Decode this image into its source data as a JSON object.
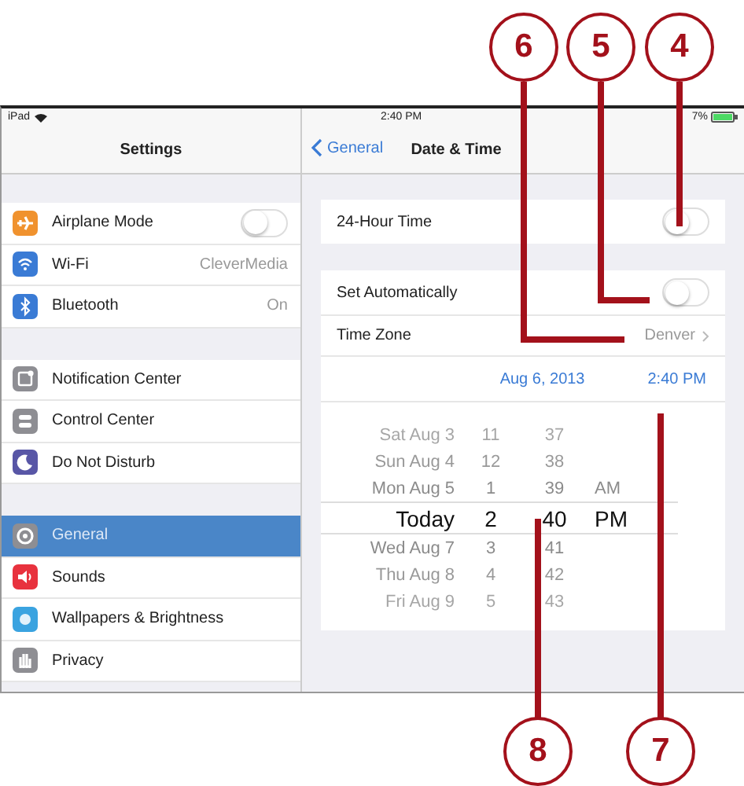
{
  "status_bar": {
    "device": "iPad",
    "time": "2:40 PM",
    "battery": "7%"
  },
  "sidebar": {
    "title": "Settings",
    "groups": [
      [
        {
          "label": "Airplane Mode",
          "kind": "toggle",
          "on": false,
          "color": "#f0922e",
          "selected": false
        },
        {
          "label": "Wi-Fi",
          "kind": "value",
          "value": "CleverMedia",
          "color": "#3a7bd5",
          "selected": false
        },
        {
          "label": "Bluetooth",
          "kind": "value",
          "value": "On",
          "color": "#3a7bd5",
          "selected": false
        }
      ],
      [
        {
          "label": "Notification Center",
          "kind": "link",
          "color": "#8e8e93",
          "selected": false
        },
        {
          "label": "Control Center",
          "kind": "link",
          "color": "#8e8e93",
          "selected": false
        },
        {
          "label": "Do Not Disturb",
          "kind": "link",
          "color": "#5856a6",
          "selected": false
        }
      ],
      [
        {
          "label": "General",
          "kind": "link",
          "color": "#8e8e93",
          "selected": true
        },
        {
          "label": "Sounds",
          "kind": "link",
          "color": "#e8323e",
          "selected": false
        },
        {
          "label": "Wallpapers & Brightness",
          "kind": "link",
          "color": "#3aa3e0",
          "selected": false
        },
        {
          "label": "Privacy",
          "kind": "link",
          "color": "#8e8e93",
          "selected": false
        }
      ]
    ]
  },
  "detail": {
    "back": "General",
    "title": "Date & Time",
    "hour24": {
      "label": "24-Hour Time",
      "on": false
    },
    "set_auto": {
      "label": "Set Automatically",
      "on": false
    },
    "time_zone": {
      "label": "Time Zone",
      "value": "Denver"
    },
    "date": "Aug 6, 2013",
    "time": "2:40 PM",
    "picker": [
      {
        "day": "Sat Aug 3",
        "hour": "11",
        "minute": "37",
        "selected": false
      },
      {
        "day": "Sun Aug 4",
        "hour": "12",
        "minute": "38",
        "selected": false
      },
      {
        "day": "Mon Aug 5",
        "hour": "1",
        "minute": "39",
        "ampm": "AM",
        "selected": false
      },
      {
        "day": "Today",
        "hour": "2",
        "minute": "40",
        "ampm": "PM",
        "selected": true
      },
      {
        "day": "Wed Aug 7",
        "hour": "3",
        "minute": "41",
        "selected": false
      },
      {
        "day": "Thu Aug 8",
        "hour": "4",
        "minute": "42",
        "selected": false
      },
      {
        "day": "Fri Aug 9",
        "hour": "5",
        "minute": "43",
        "selected": false
      }
    ]
  },
  "callouts": [
    {
      "number": "6"
    },
    {
      "number": "5"
    },
    {
      "number": "4"
    },
    {
      "number": "8"
    },
    {
      "number": "7"
    }
  ]
}
